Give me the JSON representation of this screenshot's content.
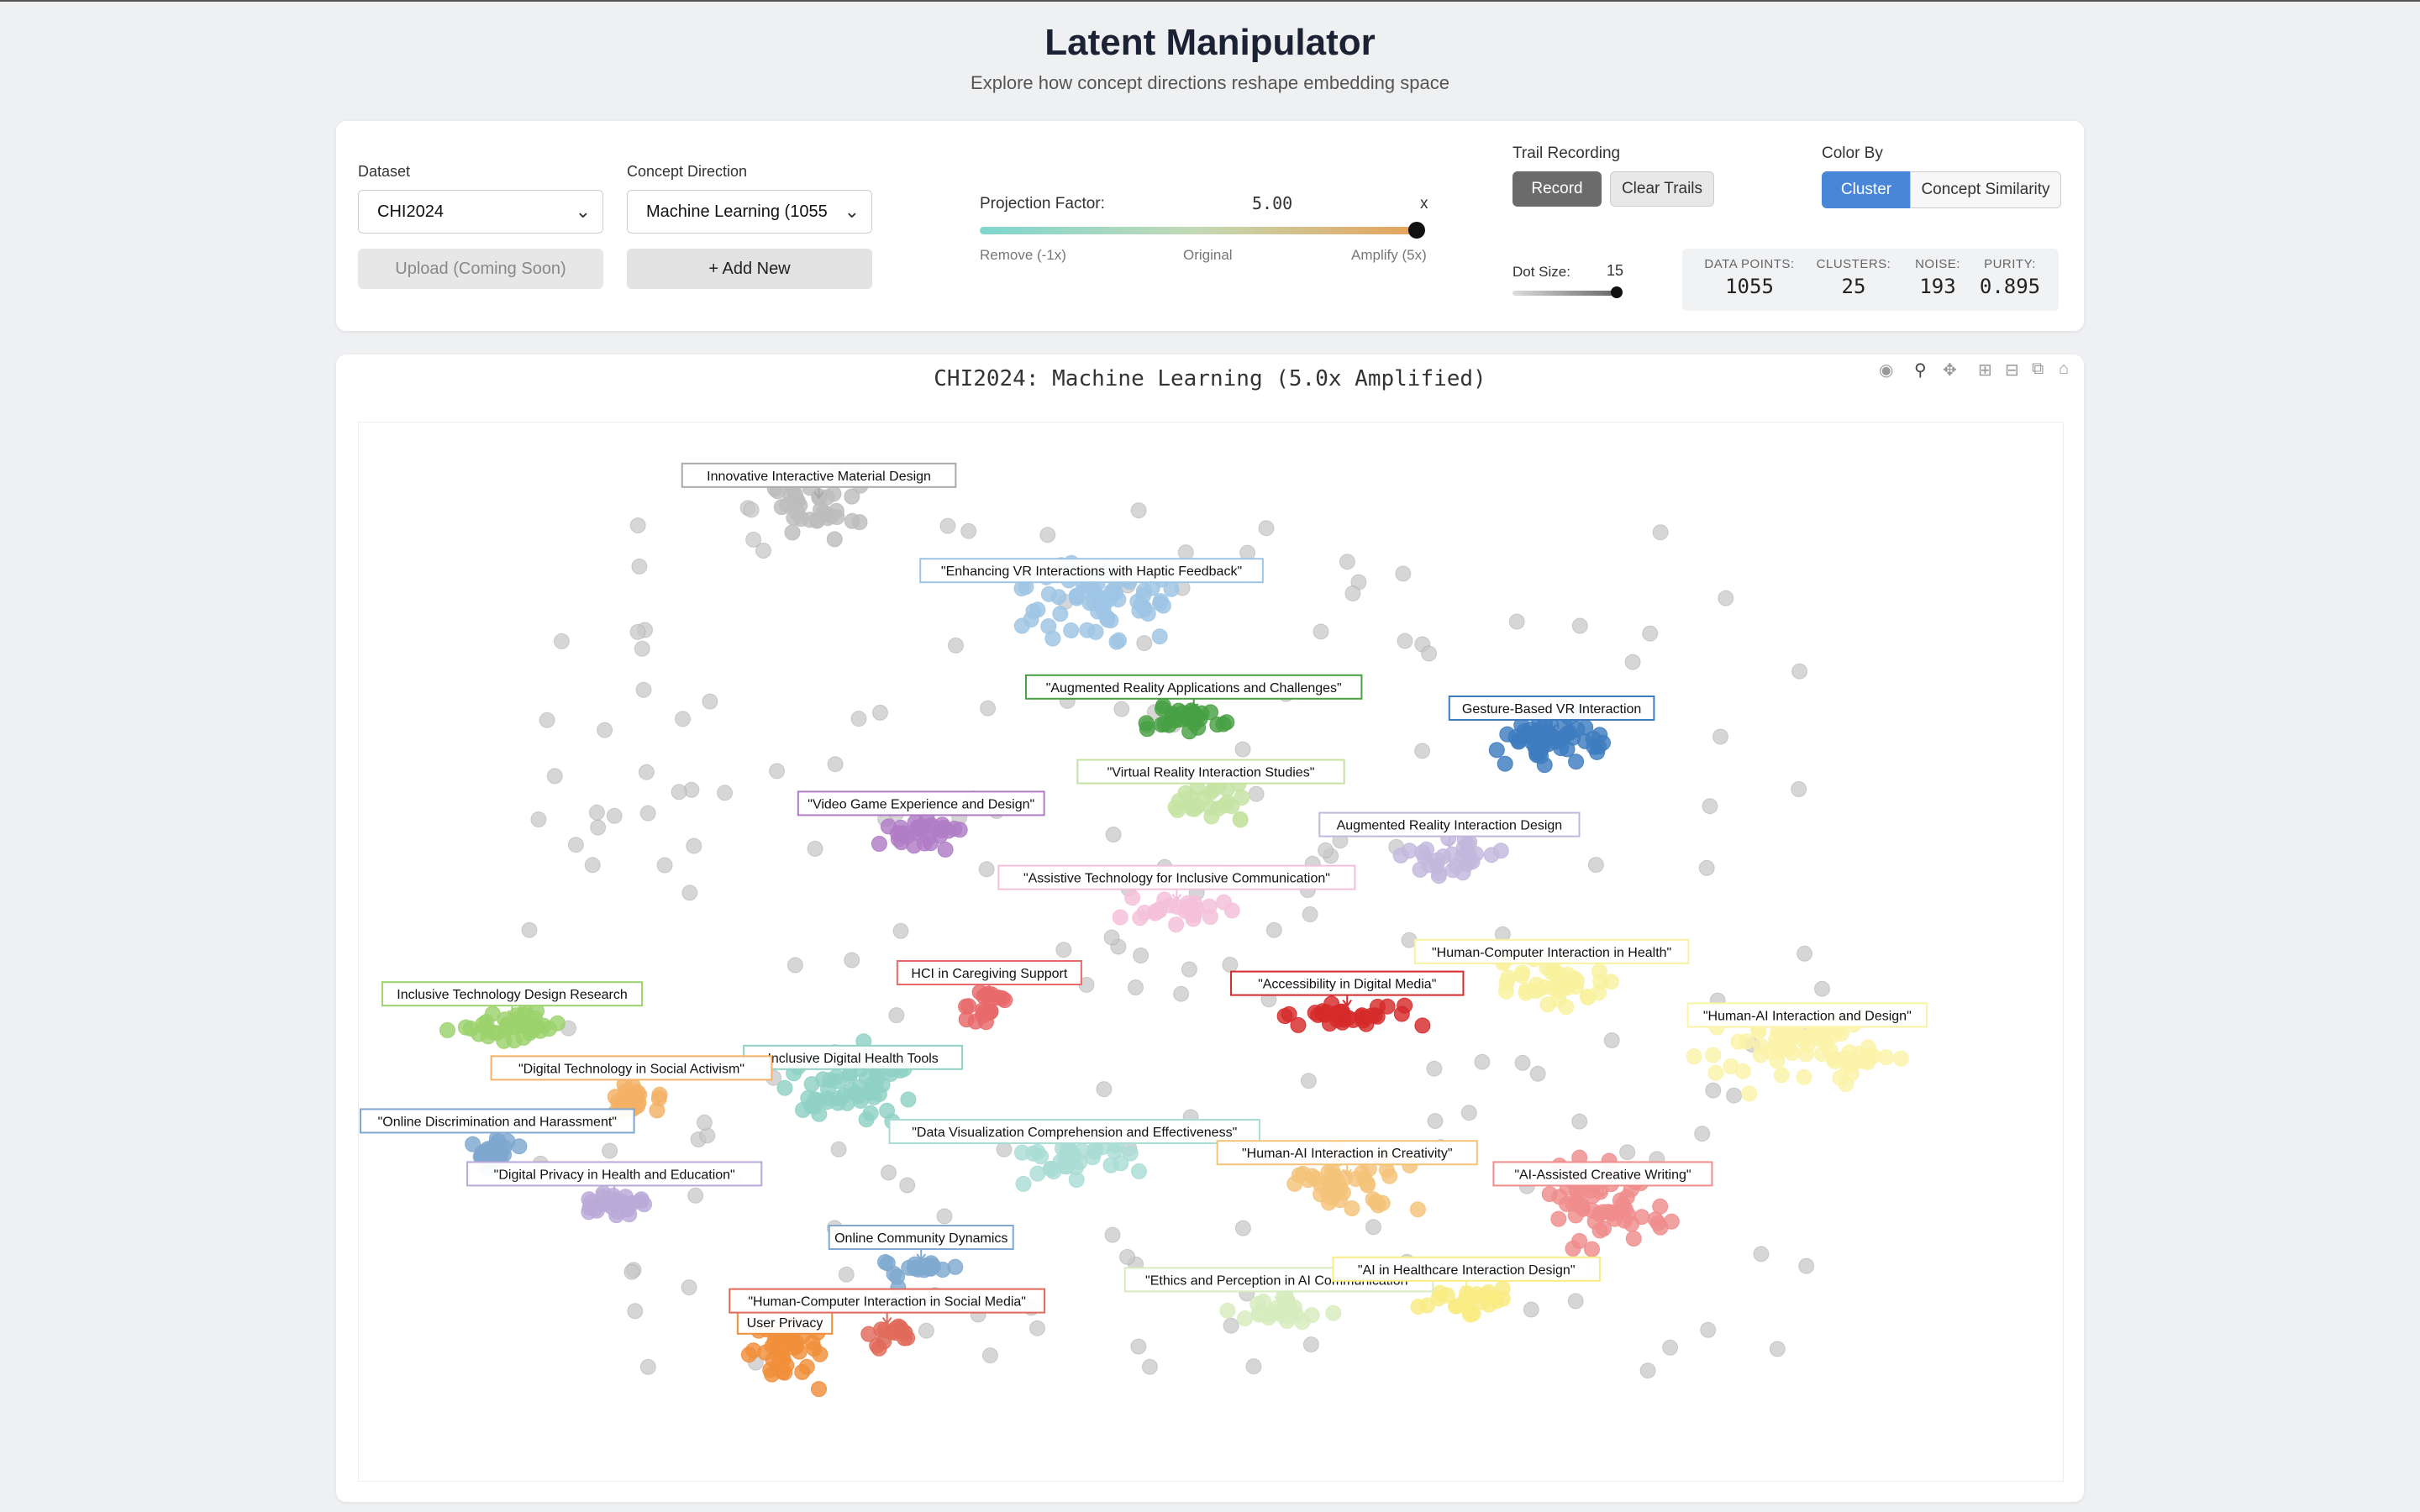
{
  "header": {
    "title": "Latent Manipulator",
    "subtitle": "Explore how concept directions reshape embedding space"
  },
  "controls": {
    "dataset_label": "Dataset",
    "dataset_value": "CHI2024",
    "upload_label": "Upload (Coming Soon)",
    "concept_label": "Concept Direction",
    "concept_value": "Machine Learning (1055",
    "add_new_label": "+ Add New",
    "projection_label": "Projection Factor:",
    "projection_value": "5.00",
    "projection_unit": "x",
    "projection_fraction": 1.0,
    "scale_left": "Remove (-1x)",
    "scale_mid": "Original",
    "scale_right": "Amplify (5x)",
    "trail_label": "Trail Recording",
    "record_label": "Record",
    "clear_label": "Clear Trails",
    "color_label": "Color By",
    "color_options": [
      "Cluster",
      "Concept Similarity"
    ],
    "color_selected": "Cluster",
    "dot_label": "Dot Size:",
    "dot_value": "15",
    "dot_fraction": 1.0
  },
  "stats": {
    "points_label": "DATA POINTS:",
    "points": "1055",
    "clusters_label": "CLUSTERS:",
    "clusters": "25",
    "noise_label": "NOISE:",
    "noise": "193",
    "purity_label": "PURITY:",
    "purity": "0.895"
  },
  "plot": {
    "title": "CHI2024: Machine Learning (5.0x Amplified)",
    "modebar_icons": [
      "camera-icon",
      "zoom-icon",
      "pan-icon",
      "zoom-in-icon",
      "zoom-out-icon",
      "autoscale-icon",
      "home-icon"
    ]
  },
  "chart_data": {
    "type": "scatter",
    "title": "CHI2024: Machine Learning (5.0x Amplified)",
    "noise_color": "#c8c8c8",
    "clusters": [
      {
        "label": "Innovative Interactive Material Design",
        "color": "#bdbdbd",
        "cx": 0.27,
        "cy": 0.08,
        "sx": 0.04,
        "sy": 0.04,
        "n": 40
      },
      {
        "label": "\"Enhancing VR Interactions with Haptic Feedback\"",
        "color": "#9ec5e4",
        "cx": 0.43,
        "cy": 0.17,
        "sx": 0.07,
        "sy": 0.05,
        "n": 70
      },
      {
        "label": "\"Augmented Reality Applications and Challenges\"",
        "color": "#47a043",
        "cx": 0.49,
        "cy": 0.28,
        "sx": 0.04,
        "sy": 0.015,
        "n": 30
      },
      {
        "label": "Gesture-Based VR Interaction",
        "color": "#3e7cbf",
        "cx": 0.7,
        "cy": 0.3,
        "sx": 0.05,
        "sy": 0.03,
        "n": 55
      },
      {
        "label": "\"Virtual Reality Interaction Studies\"",
        "color": "#c5e3a2",
        "cx": 0.5,
        "cy": 0.36,
        "sx": 0.04,
        "sy": 0.025,
        "n": 25
      },
      {
        "label": "\"Video Game Experience and Design\"",
        "color": "#b07cc6",
        "cx": 0.33,
        "cy": 0.39,
        "sx": 0.04,
        "sy": 0.02,
        "n": 30
      },
      {
        "label": "Augmented Reality Interaction Design",
        "color": "#c2b8dd",
        "cx": 0.64,
        "cy": 0.41,
        "sx": 0.04,
        "sy": 0.03,
        "n": 30
      },
      {
        "label": "\"Assistive Technology for Inclusive Communication\"",
        "color": "#f4c0d9",
        "cx": 0.48,
        "cy": 0.46,
        "sx": 0.05,
        "sy": 0.02,
        "n": 25
      },
      {
        "label": "\"Human-Computer Interaction in Health\"",
        "color": "#f8f29e",
        "cx": 0.7,
        "cy": 0.53,
        "sx": 0.05,
        "sy": 0.03,
        "n": 40
      },
      {
        "label": "HCI in Caregiving Support",
        "color": "#e8696a",
        "cx": 0.37,
        "cy": 0.55,
        "sx": 0.02,
        "sy": 0.03,
        "n": 20
      },
      {
        "label": "\"Accessibility in Digital Media\"",
        "color": "#d62b2b",
        "cx": 0.58,
        "cy": 0.56,
        "sx": 0.05,
        "sy": 0.015,
        "n": 35
      },
      {
        "label": "\"Human-AI Interaction and Design\"",
        "color": "#fbf3a8",
        "cx": 0.85,
        "cy": 0.59,
        "sx": 0.07,
        "sy": 0.05,
        "n": 70
      },
      {
        "label": "Inclusive Technology Design Research",
        "color": "#9bd26b",
        "cx": 0.09,
        "cy": 0.57,
        "sx": 0.04,
        "sy": 0.02,
        "n": 35
      },
      {
        "label": "Inclusive Digital Health Tools",
        "color": "#8fd1c5",
        "cx": 0.29,
        "cy": 0.63,
        "sx": 0.05,
        "sy": 0.05,
        "n": 55
      },
      {
        "label": "\"Digital Technology in Social Activism\"",
        "color": "#f4b167",
        "cx": 0.16,
        "cy": 0.64,
        "sx": 0.03,
        "sy": 0.02,
        "n": 25
      },
      {
        "label": "\"Online Discrimination and Harassment\"",
        "color": "#7ea7cf",
        "cx": 0.08,
        "cy": 0.69,
        "sx": 0.02,
        "sy": 0.02,
        "n": 25
      },
      {
        "label": "\"Data Visualization Comprehension and Effectiveness\"",
        "color": "#a9ddd4",
        "cx": 0.42,
        "cy": 0.7,
        "sx": 0.06,
        "sy": 0.03,
        "n": 35
      },
      {
        "label": "\"Human-AI Interaction in Creativity\"",
        "color": "#f4c37a",
        "cx": 0.58,
        "cy": 0.72,
        "sx": 0.05,
        "sy": 0.04,
        "n": 45
      },
      {
        "label": "\"AI-Assisted Creative Writing\"",
        "color": "#ef8c8c",
        "cx": 0.73,
        "cy": 0.74,
        "sx": 0.05,
        "sy": 0.06,
        "n": 60
      },
      {
        "label": "\"Digital Privacy in Health and Education\"",
        "color": "#b9a9d8",
        "cx": 0.15,
        "cy": 0.74,
        "sx": 0.03,
        "sy": 0.02,
        "n": 25
      },
      {
        "label": "Online Community Dynamics",
        "color": "#7fa9cf",
        "cx": 0.33,
        "cy": 0.8,
        "sx": 0.03,
        "sy": 0.02,
        "n": 20
      },
      {
        "label": "\"Ethics and Perception in AI Communication\"",
        "color": "#d7ecbe",
        "cx": 0.54,
        "cy": 0.84,
        "sx": 0.04,
        "sy": 0.02,
        "n": 25
      },
      {
        "label": "\"AI in Healthcare Interaction Design\"",
        "color": "#f9ec83",
        "cx": 0.65,
        "cy": 0.83,
        "sx": 0.04,
        "sy": 0.02,
        "n": 25
      },
      {
        "label": "User Privacy",
        "color": "#f08f3a",
        "cx": 0.25,
        "cy": 0.88,
        "sx": 0.03,
        "sy": 0.04,
        "n": 40
      },
      {
        "label": "\"Human-Computer Interaction in Social Media\"",
        "color": "#e06a5a",
        "cx": 0.31,
        "cy": 0.86,
        "sx": 0.02,
        "sy": 0.02,
        "n": 15
      }
    ]
  }
}
